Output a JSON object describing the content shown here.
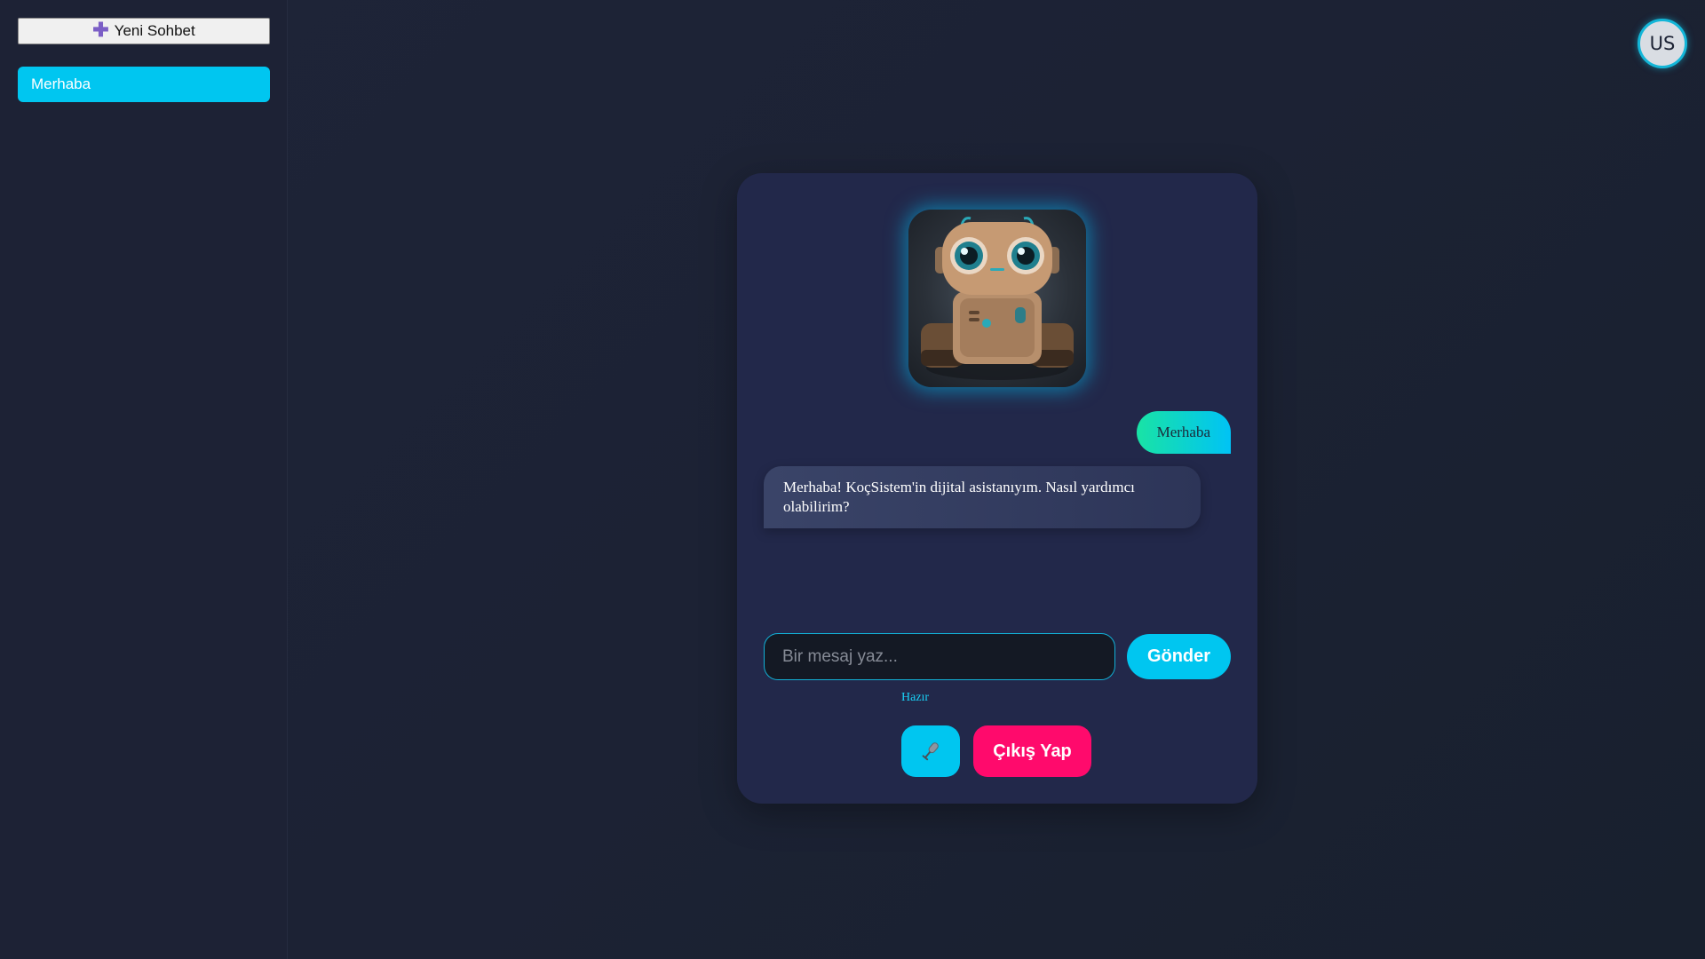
{
  "sidebar": {
    "new_chat_label": "Yeni Sohbet",
    "history": [
      {
        "label": "Merhaba"
      }
    ]
  },
  "user": {
    "avatar_initials": "US"
  },
  "chat": {
    "messages": [
      {
        "role": "user",
        "text": "Merhaba"
      },
      {
        "role": "assistant",
        "text": "Merhaba! KoçSistem'in dijital asistanıyım. Nasıl yardımcı olabilirim?"
      }
    ],
    "input_placeholder": "Bir mesaj yaz...",
    "input_value": "",
    "send_label": "Gönder",
    "status": "Hazır",
    "logout_label": "Çıkış Yap"
  },
  "colors": {
    "accent": "#00c6f0",
    "danger": "#ff0a6c",
    "card": "#22284a",
    "sidebar": "#1d2235"
  },
  "icons": {
    "new_chat": "plus-icon",
    "voice": "microphone-icon",
    "assistant": "robot-avatar"
  }
}
